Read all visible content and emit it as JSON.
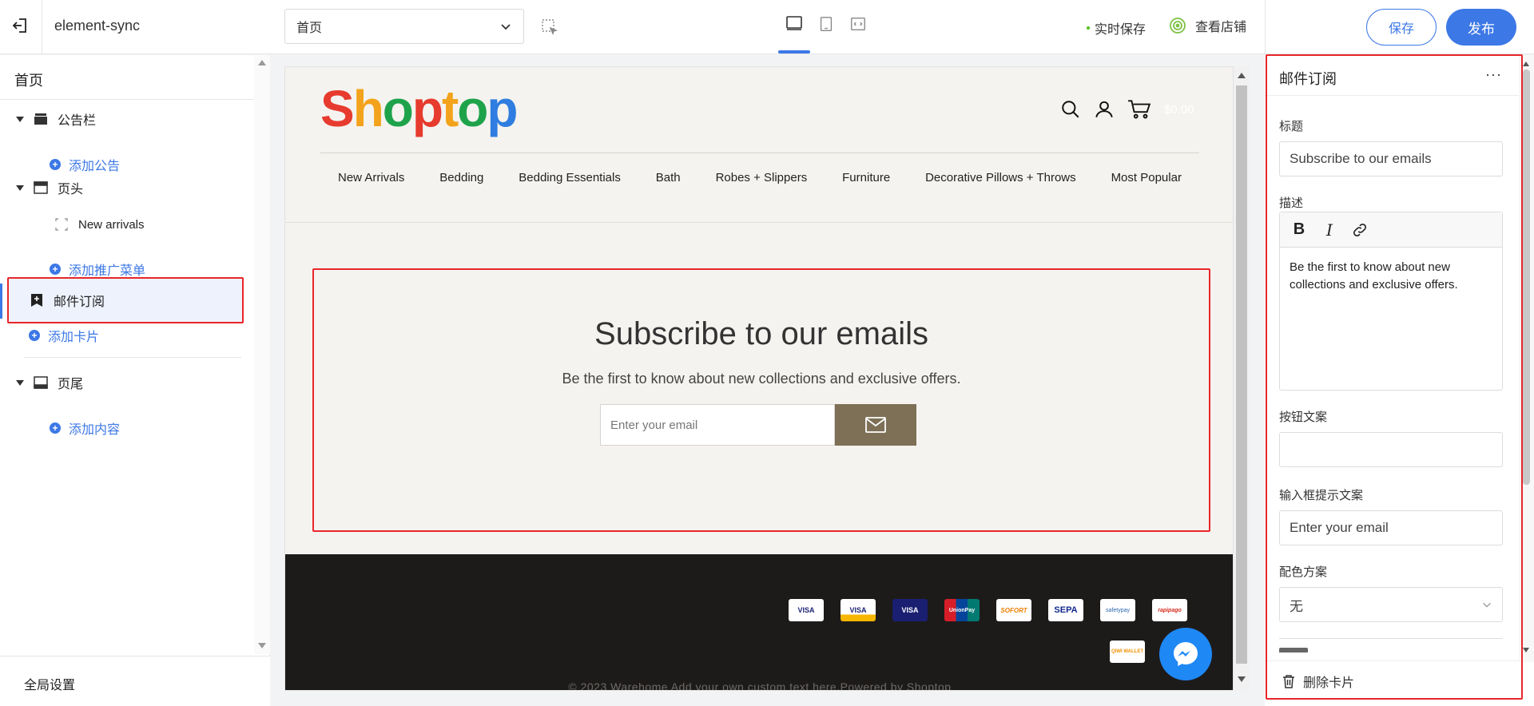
{
  "app": {
    "name": "element-sync",
    "page_select": "首页",
    "autosave": "实时保存",
    "view_store": "查看店铺",
    "save": "保存",
    "publish": "发布"
  },
  "sidebar": {
    "title": "首页",
    "sections": {
      "announcement": "公告栏",
      "add_announcement": "添加公告",
      "header": "页头",
      "new_arrivals": "New arrivals",
      "add_promo_menu": "添加推广菜单",
      "email_sub": "邮件订阅",
      "add_card": "添加卡片",
      "footer": "页尾",
      "add_content": "添加内容"
    },
    "global_settings": "全局设置"
  },
  "preview": {
    "logo_letters": [
      "S",
      "h",
      "o",
      "p",
      "t",
      "o",
      "p"
    ],
    "cart_total": "$0.00",
    "nav": [
      "New Arrivals",
      "Bedding",
      "Bedding Essentials",
      "Bath",
      "Robes + Slippers",
      "Furniture",
      "Decorative Pillows + Throws",
      "Most Popular"
    ],
    "subscribe": {
      "title": "Subscribe to our emails",
      "description": "Be the first to know about new collections and exclusive offers.",
      "placeholder": "Enter your email"
    },
    "payments": [
      "VISA",
      "VISA",
      "VISA",
      "UnionPay",
      "SOFORT",
      "SEPA",
      "safetypay",
      "rapipago"
    ],
    "payments_row2": [
      "QIWI WALLET"
    ],
    "copyright": "© 2023 Warehome Add your own custom text here.Powered by Shoptop"
  },
  "panel": {
    "title": "邮件订阅",
    "more": "···",
    "label_title": "标题",
    "value_title": "Subscribe to our emails",
    "label_desc": "描述",
    "tool_bold": "B",
    "tool_italic": "I",
    "desc_text": "Be the first to know about new collections and exclusive offers.",
    "label_button": "按钮文案",
    "value_button": "",
    "label_placeholder": "输入框提示文案",
    "value_placeholder": "Enter your email",
    "label_color": "配色方案",
    "value_color": "无",
    "delete_card": "删除卡片"
  },
  "colors": {
    "accent": "#3c78e6",
    "highlight": "#e8262a",
    "subscribe_button": "#7d7056",
    "footer_bg": "#1d1b1a"
  }
}
